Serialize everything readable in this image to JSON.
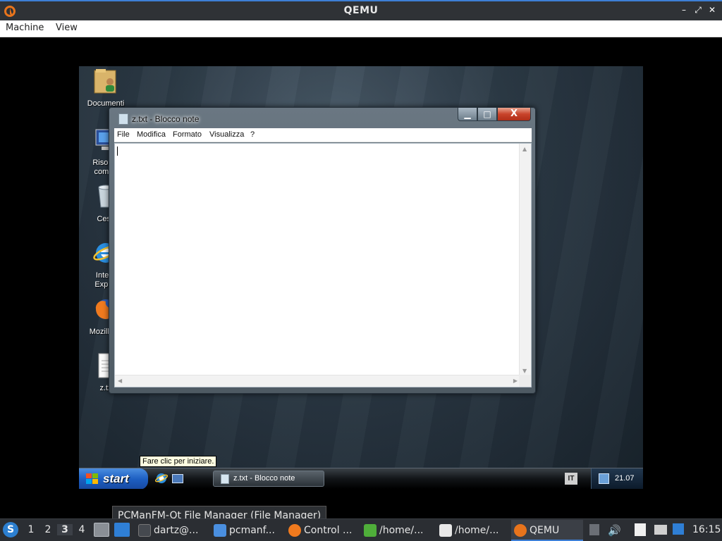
{
  "host_window": {
    "title": "QEMU",
    "menu": [
      "Machine",
      "View"
    ],
    "controls": {
      "minimize": "–",
      "restore": "⤢",
      "close": "✕"
    }
  },
  "guest": {
    "desktop_icons": [
      {
        "label": "Documenti",
        "icon": "folder-user-icon"
      },
      {
        "label": "Risorse del computer",
        "label_visible": "Risorse\ncompu",
        "icon": "computer-icon"
      },
      {
        "label": "Cestino",
        "label_visible": "Cesti",
        "icon": "recycle-bin-icon"
      },
      {
        "label": "Internet Explorer",
        "label_visible": "Intern\nExplor",
        "icon": "internet-explorer-icon"
      },
      {
        "label": "Mozilla Firefox",
        "label_visible": "Mozilla Fi",
        "icon": "firefox-icon"
      },
      {
        "label": "z.txt",
        "label_visible": "z.tx",
        "icon": "text-file-icon"
      }
    ],
    "notepad": {
      "title": "z.txt - Blocco note",
      "menu": [
        "File",
        "Modifica",
        "Formato",
        "Visualizza",
        "?"
      ],
      "close_glyph": "X",
      "content": ""
    },
    "taskbar": {
      "start_label": "start",
      "tooltip": "Fare clic per iniziare.",
      "task_label": "z.txt - Blocco note",
      "language": "IT",
      "clock": "21.07"
    }
  },
  "host_tooltip": "PCManFM-Qt File Manager (File Manager)",
  "host_taskbar": {
    "workspaces": [
      "1",
      "2",
      "3",
      "4"
    ],
    "active_workspace": "3",
    "tasks": [
      {
        "label": "dartz@...",
        "icon": "terminal-icon"
      },
      {
        "label": "pcmanf...",
        "icon": "folder-icon"
      },
      {
        "label": "Control ...",
        "icon": "firefox-icon"
      },
      {
        "label": "/home/...",
        "icon": "archive-icon"
      },
      {
        "label": "/home/...",
        "icon": "text-editor-icon"
      },
      {
        "label": "QEMU",
        "icon": "qemu-icon",
        "active": true
      }
    ],
    "clock": "16:15"
  },
  "colors": {
    "accent": "#3d7fd6",
    "host_panel": "#2b2e33",
    "start_button": "#1d5fc2",
    "close_button": "#c8432a"
  }
}
